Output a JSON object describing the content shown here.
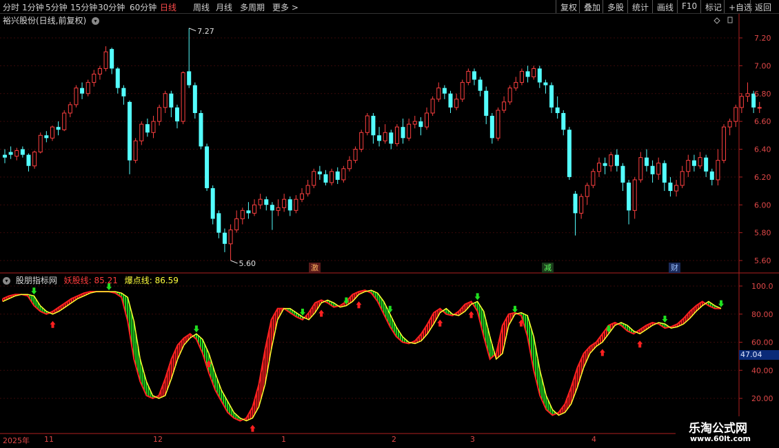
{
  "toolbar": {
    "periods": [
      "分时",
      "1分钟",
      "5分钟",
      "15分钟",
      "30分钟",
      "60分钟",
      "日线",
      "周线",
      "月线",
      "多周期",
      "更多 >"
    ],
    "active_period": "日线",
    "right_buttons": [
      "复权",
      "叠加",
      "多股",
      "统计",
      "画线",
      "F10",
      "标记",
      "+自选",
      "返回"
    ]
  },
  "price_panel": {
    "title": "裕兴股份(日线,前复权)",
    "y_ticks": [
      "7.20",
      "7.00",
      "6.80",
      "6.60",
      "6.40",
      "6.20",
      "6.00",
      "5.80",
      "5.60"
    ],
    "high_marker": "7.27",
    "low_marker": "5.60",
    "event_badges": [
      "激",
      "减",
      "财"
    ],
    "candles": [
      [
        6.36,
        6.34,
        6.4,
        6.3
      ],
      [
        6.38,
        6.36,
        6.42,
        6.33
      ],
      [
        6.35,
        6.39,
        6.41,
        6.32
      ],
      [
        6.4,
        6.36,
        6.42,
        6.34
      ],
      [
        6.36,
        6.28,
        6.37,
        6.24
      ],
      [
        6.28,
        6.38,
        6.39,
        6.26
      ],
      [
        6.38,
        6.5,
        6.52,
        6.37
      ],
      [
        6.5,
        6.48,
        6.53,
        6.45
      ],
      [
        6.48,
        6.56,
        6.57,
        6.46
      ],
      [
        6.56,
        6.54,
        6.6,
        6.5
      ],
      [
        6.54,
        6.66,
        6.68,
        6.53
      ],
      [
        6.66,
        6.72,
        6.74,
        6.63
      ],
      [
        6.72,
        6.84,
        6.86,
        6.7
      ],
      [
        6.84,
        6.8,
        6.88,
        6.76
      ],
      [
        6.8,
        6.88,
        6.9,
        6.78
      ],
      [
        6.88,
        6.94,
        6.97,
        6.85
      ],
      [
        6.94,
        6.98,
        7.0,
        6.9
      ],
      [
        6.98,
        7.1,
        7.14,
        6.96
      ],
      [
        7.12,
        6.98,
        7.13,
        6.94
      ],
      [
        6.98,
        6.84,
        6.99,
        6.8
      ],
      [
        6.84,
        6.78,
        6.86,
        6.72
      ],
      [
        6.74,
        6.32,
        6.75,
        6.22
      ],
      [
        6.32,
        6.46,
        6.48,
        6.3
      ],
      [
        6.46,
        6.58,
        6.6,
        6.43
      ],
      [
        6.58,
        6.52,
        6.62,
        6.49
      ],
      [
        6.52,
        6.6,
        6.64,
        6.48
      ],
      [
        6.6,
        6.7,
        6.72,
        6.57
      ],
      [
        6.7,
        6.8,
        6.82,
        6.66
      ],
      [
        6.8,
        6.7,
        6.82,
        6.63
      ],
      [
        6.7,
        6.6,
        6.72,
        6.55
      ],
      [
        6.6,
        6.95,
        6.96,
        6.58
      ],
      [
        6.96,
        6.86,
        7.27,
        6.84
      ],
      [
        6.86,
        6.66,
        6.88,
        6.62
      ],
      [
        6.66,
        6.42,
        6.68,
        6.4
      ],
      [
        6.42,
        6.12,
        6.44,
        6.1
      ],
      [
        6.12,
        5.9,
        6.14,
        5.86
      ],
      [
        5.94,
        5.8,
        5.96,
        5.76
      ],
      [
        5.8,
        5.72,
        5.83,
        5.66
      ],
      [
        5.72,
        5.82,
        5.86,
        5.6
      ],
      [
        5.82,
        5.9,
        5.96,
        5.8
      ],
      [
        5.9,
        5.96,
        5.98,
        5.86
      ],
      [
        5.96,
        5.94,
        6.02,
        5.9
      ],
      [
        5.94,
        6.0,
        6.04,
        5.92
      ],
      [
        6.0,
        6.04,
        6.08,
        5.97
      ],
      [
        6.04,
        6.0,
        6.06,
        5.96
      ],
      [
        6.0,
        5.96,
        6.02,
        5.82
      ],
      [
        5.96,
        5.98,
        6.04,
        5.92
      ],
      [
        5.98,
        6.04,
        6.08,
        5.95
      ],
      [
        6.04,
        5.96,
        6.06,
        5.92
      ],
      [
        5.96,
        6.04,
        6.07,
        5.94
      ],
      [
        6.04,
        6.08,
        6.12,
        6.02
      ],
      [
        6.08,
        6.14,
        6.18,
        6.06
      ],
      [
        6.14,
        6.24,
        6.26,
        6.12
      ],
      [
        6.24,
        6.22,
        6.28,
        6.18
      ],
      [
        6.22,
        6.16,
        6.25,
        6.14
      ],
      [
        6.16,
        6.24,
        6.26,
        6.14
      ],
      [
        6.24,
        6.18,
        6.27,
        6.15
      ],
      [
        6.18,
        6.26,
        6.28,
        6.16
      ],
      [
        6.26,
        6.32,
        6.35,
        6.24
      ],
      [
        6.32,
        6.4,
        6.42,
        6.3
      ],
      [
        6.4,
        6.52,
        6.54,
        6.38
      ],
      [
        6.52,
        6.64,
        6.66,
        6.5
      ],
      [
        6.64,
        6.5,
        6.66,
        6.44
      ],
      [
        6.5,
        6.46,
        6.56,
        6.42
      ],
      [
        6.46,
        6.52,
        6.58,
        6.44
      ],
      [
        6.52,
        6.44,
        6.54,
        6.4
      ],
      [
        6.44,
        6.56,
        6.58,
        6.42
      ],
      [
        6.56,
        6.48,
        6.62,
        6.44
      ],
      [
        6.48,
        6.58,
        6.62,
        6.46
      ],
      [
        6.58,
        6.6,
        6.64,
        6.55
      ],
      [
        6.6,
        6.56,
        6.63,
        6.5
      ],
      [
        6.56,
        6.66,
        6.7,
        6.54
      ],
      [
        6.66,
        6.76,
        6.78,
        6.64
      ],
      [
        6.76,
        6.84,
        6.88,
        6.74
      ],
      [
        6.84,
        6.8,
        6.86,
        6.76
      ],
      [
        6.8,
        6.7,
        6.82,
        6.66
      ],
      [
        6.7,
        6.76,
        6.8,
        6.68
      ],
      [
        6.76,
        6.88,
        6.9,
        6.74
      ],
      [
        6.88,
        6.96,
        6.98,
        6.86
      ],
      [
        6.96,
        6.9,
        6.98,
        6.86
      ],
      [
        6.9,
        6.82,
        6.92,
        6.78
      ],
      [
        6.82,
        6.64,
        6.85,
        6.58
      ],
      [
        6.64,
        6.48,
        6.66,
        6.44
      ],
      [
        6.48,
        6.68,
        6.7,
        6.46
      ],
      [
        6.68,
        6.74,
        6.78,
        6.66
      ],
      [
        6.74,
        6.84,
        6.86,
        6.72
      ],
      [
        6.84,
        6.88,
        6.92,
        6.82
      ],
      [
        6.88,
        6.96,
        6.98,
        6.86
      ],
      [
        6.96,
        6.92,
        7.0,
        6.88
      ],
      [
        6.92,
        6.98,
        7.0,
        6.9
      ],
      [
        6.98,
        6.88,
        7.0,
        6.84
      ],
      [
        6.88,
        6.86,
        6.9,
        6.8
      ],
      [
        6.86,
        6.7,
        6.88,
        6.66
      ],
      [
        6.7,
        6.66,
        6.78,
        6.62
      ],
      [
        6.66,
        6.54,
        6.68,
        6.5
      ],
      [
        6.54,
        6.2,
        6.56,
        6.18
      ],
      [
        6.08,
        5.94,
        6.1,
        5.78
      ],
      [
        5.94,
        6.06,
        6.08,
        5.9
      ],
      [
        6.06,
        6.14,
        6.16,
        6.0
      ],
      [
        6.14,
        6.24,
        6.26,
        6.12
      ],
      [
        6.24,
        6.3,
        6.34,
        6.2
      ],
      [
        6.3,
        6.28,
        6.34,
        6.22
      ],
      [
        6.28,
        6.36,
        6.38,
        6.24
      ],
      [
        6.36,
        6.28,
        6.4,
        6.24
      ],
      [
        6.28,
        6.16,
        6.3,
        6.1
      ],
      [
        6.16,
        5.96,
        6.18,
        5.86
      ],
      [
        5.96,
        6.18,
        6.2,
        5.9
      ],
      [
        6.18,
        6.34,
        6.38,
        6.16
      ],
      [
        6.34,
        6.28,
        6.4,
        6.24
      ],
      [
        6.28,
        6.22,
        6.32,
        6.16
      ],
      [
        6.22,
        6.3,
        6.34,
        6.18
      ],
      [
        6.3,
        6.16,
        6.32,
        6.1
      ],
      [
        6.16,
        6.1,
        6.2,
        6.06
      ],
      [
        6.1,
        6.14,
        6.18,
        6.06
      ],
      [
        6.14,
        6.24,
        6.28,
        6.12
      ],
      [
        6.24,
        6.32,
        6.36,
        6.2
      ],
      [
        6.32,
        6.28,
        6.36,
        6.24
      ],
      [
        6.28,
        6.34,
        6.38,
        6.26
      ],
      [
        6.34,
        6.24,
        6.36,
        6.2
      ],
      [
        6.24,
        6.18,
        6.26,
        6.14
      ],
      [
        6.18,
        6.32,
        6.4,
        6.14
      ],
      [
        6.32,
        6.56,
        6.58,
        6.3
      ],
      [
        6.56,
        6.6,
        6.62,
        6.5
      ],
      [
        6.6,
        6.7,
        6.72,
        6.56
      ],
      [
        6.7,
        6.78,
        6.8,
        6.66
      ],
      [
        6.78,
        6.8,
        6.88,
        6.74
      ],
      [
        6.8,
        6.7,
        6.82,
        6.66
      ],
      [
        6.7,
        6.7,
        6.74,
        6.66
      ]
    ]
  },
  "indicator_panel": {
    "name": "股朋指标网",
    "line1_label": "妖股线: 85.21",
    "line2_label": "爆点线: 86.59",
    "y_ticks": [
      "100.0",
      "80.00",
      "60.00",
      "40.00",
      "20.00"
    ],
    "current_value": "47.04",
    "line_points": [
      89,
      91,
      93,
      94,
      94,
      93,
      86,
      82,
      80,
      82,
      85,
      88,
      91,
      93,
      95,
      96,
      96,
      96,
      96,
      95,
      92,
      75,
      48,
      32,
      22,
      20,
      22,
      34,
      48,
      58,
      63,
      66,
      62,
      52,
      38,
      26,
      18,
      10,
      6,
      4,
      6,
      14,
      30,
      55,
      76,
      84,
      84,
      81,
      78,
      76,
      81,
      88,
      90,
      88,
      85,
      86,
      89,
      94,
      96,
      97,
      95,
      89,
      80,
      71,
      64,
      60,
      59,
      61,
      66,
      73,
      81,
      84,
      80,
      79,
      82,
      87,
      89,
      82,
      64,
      48,
      52,
      72,
      80,
      81,
      79,
      64,
      40,
      22,
      12,
      8,
      10,
      16,
      28,
      42,
      52,
      57,
      60,
      66,
      72,
      74,
      72,
      68,
      66,
      69,
      72,
      74,
      73,
      70,
      71,
      73,
      77,
      82,
      86,
      89,
      86,
      84
    ],
    "up_arrows": [
      8,
      33,
      40,
      51,
      57,
      70,
      75,
      83,
      96,
      102
    ],
    "down_arrows": [
      5,
      17,
      31,
      48,
      55,
      62,
      76,
      82,
      97,
      106,
      115
    ]
  },
  "date_axis": {
    "labels": [
      "2025年",
      "11",
      "12",
      "1",
      "2",
      "3",
      "4"
    ]
  },
  "watermark": {
    "title": "乐淘公式网",
    "url": "www.60lt.com"
  }
}
